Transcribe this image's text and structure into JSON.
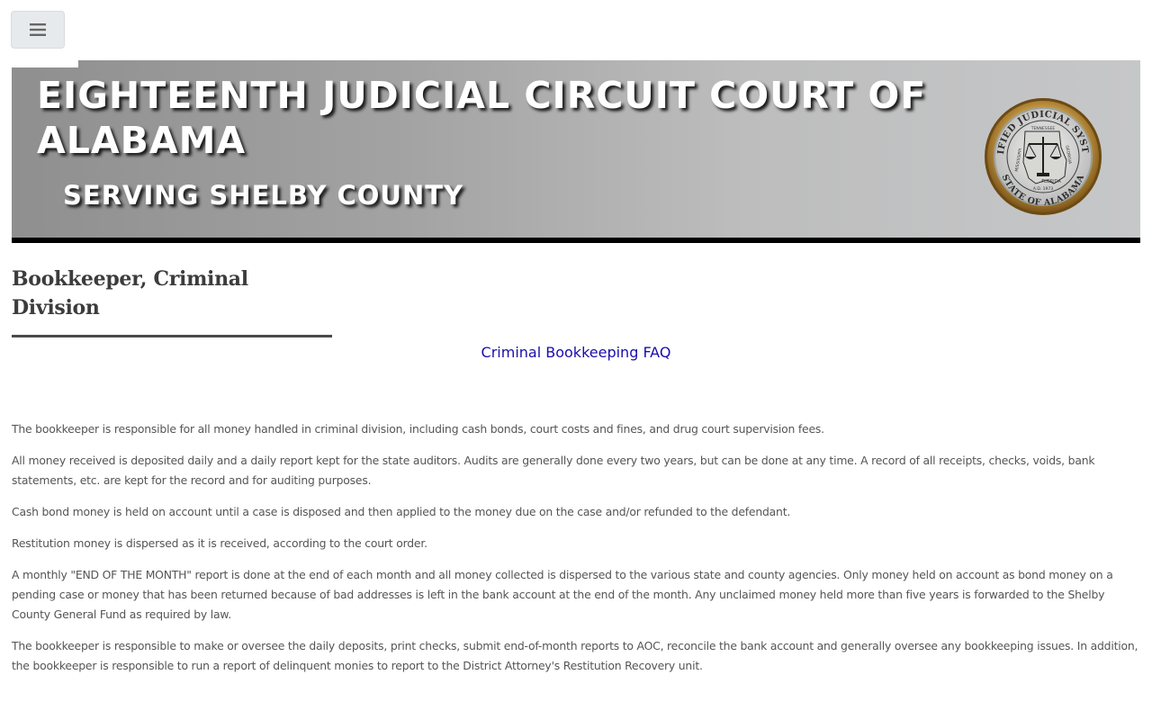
{
  "menu": {
    "toggle_icon": "hamburger-menu-icon"
  },
  "header": {
    "title": "EIGHTEENTH JUDICIAL CIRCUIT COURT OF ALABAMA",
    "subtitle": "SERVING SHELBY COUNTY",
    "seal": {
      "icon": "unified-judicial-system-seal",
      "text_top": "UNIFIED JUDICIAL SYSTEM",
      "text_bottom": "STATE OF ALABAMA",
      "map_labels": [
        "MISSISSIPPI",
        "TENNESSEE",
        "GEORGIA",
        "FLORIDA"
      ],
      "date": "A.D. 1973"
    }
  },
  "page": {
    "heading": "Bookkeeper, Criminal Division",
    "faq_link": "Criminal Bookkeeping FAQ",
    "paragraphs": [
      "The bookkeeper is responsible for all money handled in criminal division, including cash bonds, court costs and fines, and drug court supervision fees.",
      "All money received is deposited daily and a daily report kept for the state auditors. Audits are generally done every two years, but can be done at any time. A record of all receipts, checks, voids, bank statements, etc. are kept for the record and for auditing purposes.",
      "Cash bond money is held on account until a case is disposed and then applied to the money due on the case and/or refunded to the defendant.",
      "Restitution money is dispersed as it is received, according to the court order.",
      "A monthly \"END OF THE MONTH\" report is done at the end of each month and all money collected is dispersed to the various state and county agencies. Only money held on account as bond money on a pending case or money that has been returned because of bad addresses is left in the bank account at the end of the month. Any unclaimed money held more than five years is forwarded to the Shelby County General Fund as required by law.",
      "The bookkeeper is responsible to make or oversee the daily deposits, print checks, submit end-of-month reports to AOC, reconcile the bank account and generally oversee any bookkeeping issues. In addition, the bookkeeper is responsible to run a report of delinquent monies to report to the District Attorney's Restitution Recovery unit."
    ]
  },
  "colors": {
    "banner_start": "#8f8f8f",
    "banner_end": "#c6c7c9",
    "banner_border": "#000000",
    "link": "#1a0dab",
    "body_text": "#555555",
    "heading_text": "#3c3c3c"
  }
}
